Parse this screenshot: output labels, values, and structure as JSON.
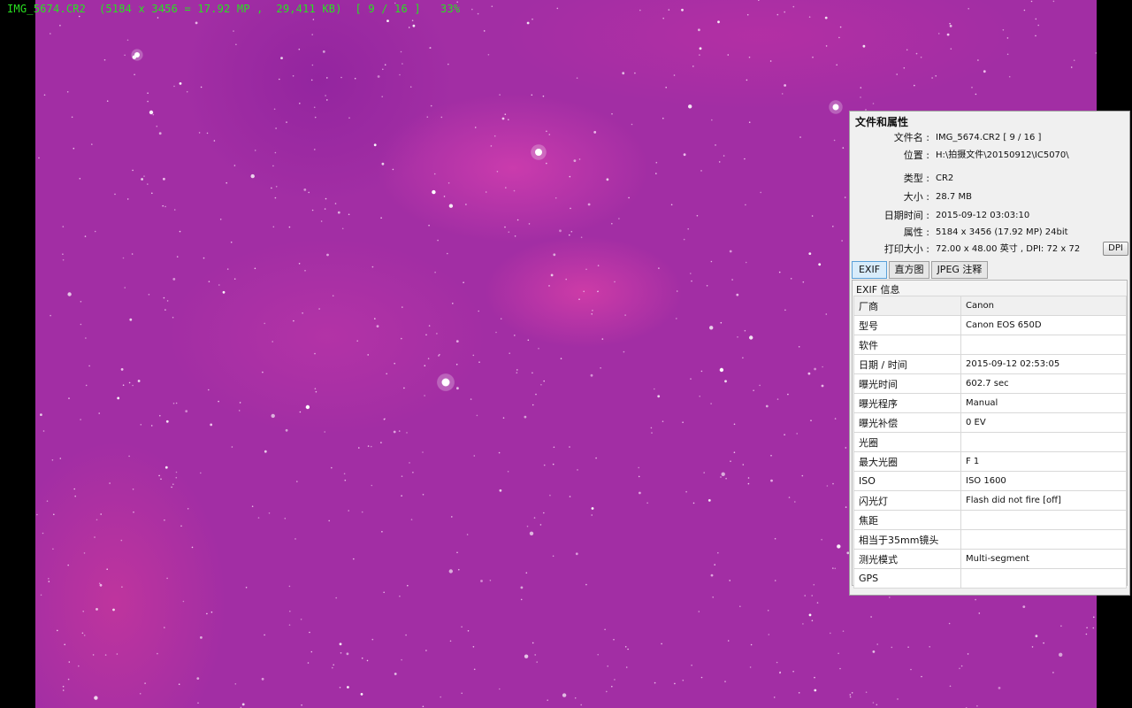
{
  "viewer": {
    "title_bar": "IMG_5674.CR2  (5184 x 3456 = 17.92 MP ,  29,411 KB)  [ 9 / 16 ]   33%"
  },
  "panel": {
    "title": "文件和属性",
    "fields": [
      {
        "label": "文件名 :",
        "value": "IMG_5674.CR2   [ 9 / 16 ]"
      },
      {
        "label": "位置 :",
        "value": "H:\\拍摄文件\\20150912\\IC5070\\"
      },
      {
        "label": "类型 :",
        "value": "CR2"
      },
      {
        "label": "大小 :",
        "value": "28.7 MB"
      },
      {
        "label": "日期时间 :",
        "value": "2015-09-12 03:03:10"
      },
      {
        "label": "属性 :",
        "value": "5184 x 3456 (17.92 MP)  24bit"
      },
      {
        "label": "打印大小 :",
        "value": "72.00 x 48.00 英寸 ,   DPI: 72 x 72"
      }
    ],
    "dpi_button": "DPI",
    "tabs": [
      {
        "label": "EXIF",
        "active": true
      },
      {
        "label": "直方图",
        "active": false
      },
      {
        "label": "JPEG 注释",
        "active": false
      }
    ],
    "exif_section": "EXIF 信息",
    "exif": [
      {
        "key": "厂商",
        "value": "Canon"
      },
      {
        "key": "型号",
        "value": "Canon EOS 650D"
      },
      {
        "key": "软件",
        "value": ""
      },
      {
        "key": "日期 / 时间",
        "value": "2015-09-12 02:53:05"
      },
      {
        "key": "曝光时间",
        "value": "602.7 sec"
      },
      {
        "key": "曝光程序",
        "value": "Manual"
      },
      {
        "key": "曝光补偿",
        "value": "0 EV"
      },
      {
        "key": "光圈",
        "value": ""
      },
      {
        "key": "最大光圈",
        "value": "F 1"
      },
      {
        "key": "ISO",
        "value": "ISO 1600"
      },
      {
        "key": "闪光灯",
        "value": "Flash did not fire [off]"
      },
      {
        "key": "焦距",
        "value": ""
      },
      {
        "key": "相当于35mm镜头",
        "value": ""
      },
      {
        "key": "测光模式",
        "value": "Multi-segment"
      },
      {
        "key": "GPS",
        "value": ""
      }
    ]
  },
  "colors": {
    "title_text": "#29e020",
    "sky": "#a22ea4",
    "nebula": "#e84fb4"
  }
}
